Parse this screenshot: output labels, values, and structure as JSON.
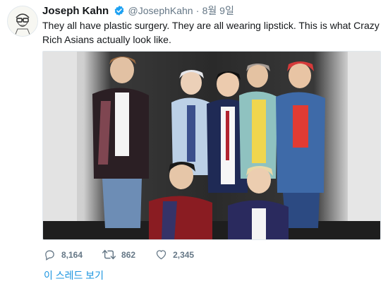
{
  "tweet": {
    "author_name": "Joseph Kahn",
    "handle": "@JosephKahn",
    "separator": "·",
    "date": "8월 9일",
    "text": "They all have plastic surgery. They are all wearing lipstick. This is what Crazy Rich Asians actually look like."
  },
  "actions": {
    "replies": "8,164",
    "retweets": "862",
    "likes": "2,345"
  },
  "thread_link": "이 스레드 보기",
  "colors": {
    "accent": "#1da1f2",
    "link": "#1b95e0",
    "secondary_text": "#657786"
  },
  "icons": [
    "verified-badge-icon",
    "reply-icon",
    "retweet-icon",
    "like-icon"
  ]
}
